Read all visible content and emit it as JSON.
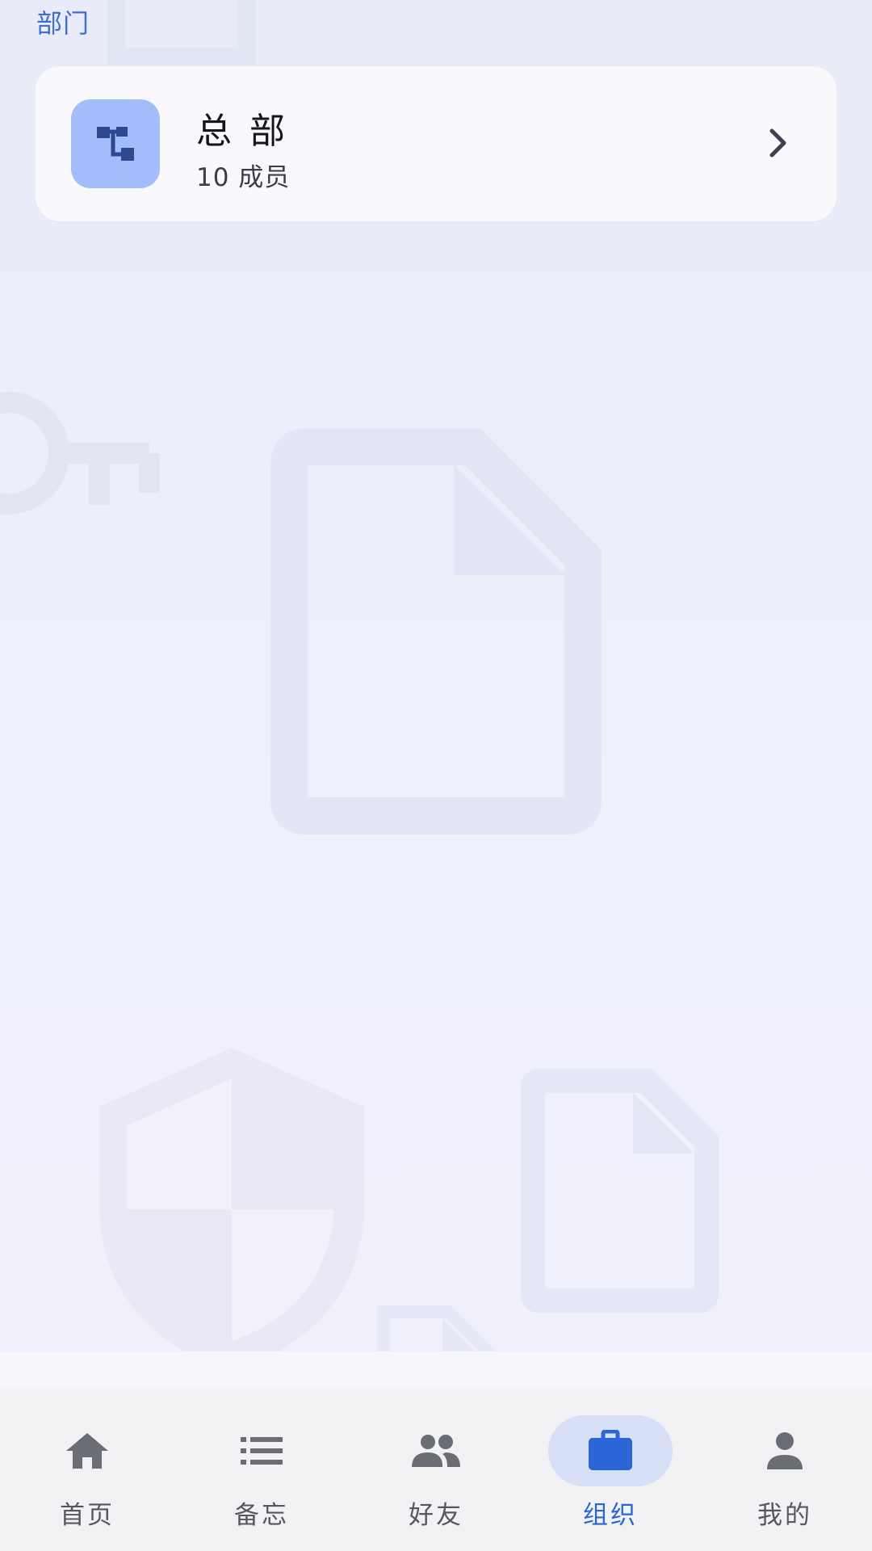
{
  "section": {
    "label": "部门"
  },
  "department": {
    "icon": "org-tree-icon",
    "name": "总部",
    "count_text": "10 成员",
    "chevron": "chevron-right-icon"
  },
  "nav": {
    "items": [
      {
        "label": "首页",
        "icon": "home-icon",
        "active": false
      },
      {
        "label": "备忘",
        "icon": "list-icon",
        "active": false
      },
      {
        "label": "好友",
        "icon": "people-icon",
        "active": false
      },
      {
        "label": "组织",
        "icon": "briefcase-icon",
        "active": true
      },
      {
        "label": "我的",
        "icon": "person-icon",
        "active": false
      }
    ]
  },
  "colors": {
    "accent": "#2a66d8",
    "avatar_bg": "#a3bdfb",
    "avatar_icon": "#2b4a8f",
    "active_pill": "#d7e0f6"
  }
}
